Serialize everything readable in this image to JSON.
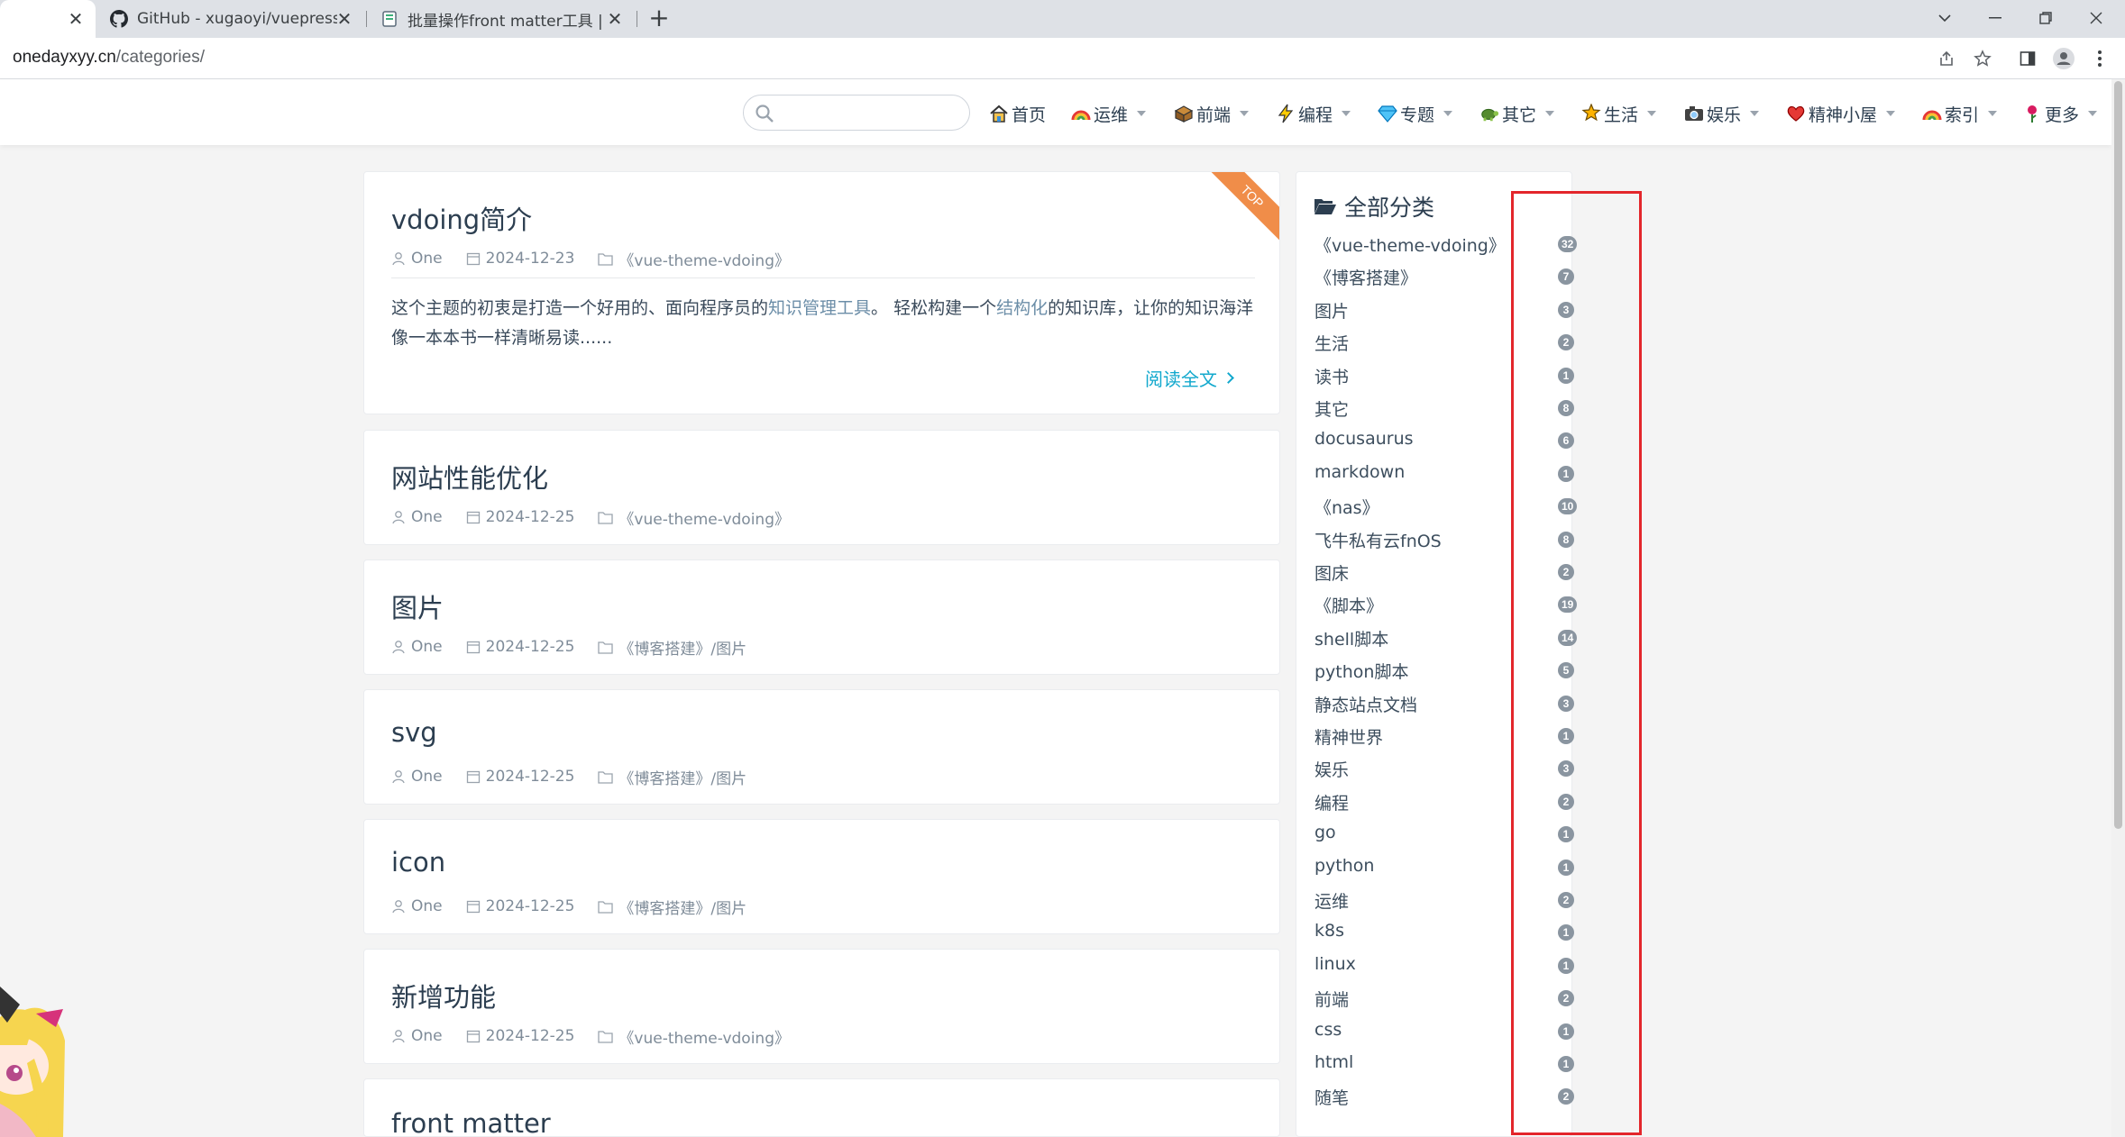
{
  "browser": {
    "tabs": [
      {
        "title": "",
        "active": true
      },
      {
        "title": "GitHub - xugaoyi/vuepress-the",
        "favicon": "github-icon"
      },
      {
        "title": "批量操作front matter工具 | vue",
        "favicon": "page-icon"
      }
    ],
    "url_host": "onedayxyy.cn",
    "url_path": "/categories/"
  },
  "nav": {
    "search_placeholder": "",
    "items": [
      {
        "label": "首页",
        "icon": "home-icon",
        "dropdown": false
      },
      {
        "label": "运维",
        "icon": "rainbow-icon",
        "dropdown": true
      },
      {
        "label": "前端",
        "icon": "box-icon",
        "dropdown": true
      },
      {
        "label": "编程",
        "icon": "lightning-icon",
        "dropdown": true
      },
      {
        "label": "专题",
        "icon": "gem-icon",
        "dropdown": true
      },
      {
        "label": "其它",
        "icon": "turtle-icon",
        "dropdown": true
      },
      {
        "label": "生活",
        "icon": "star-person-icon",
        "dropdown": true
      },
      {
        "label": "娱乐",
        "icon": "camera-icon",
        "dropdown": true
      },
      {
        "label": "精神小屋",
        "icon": "heart-icon",
        "dropdown": true
      },
      {
        "label": "索引",
        "icon": "rainbow-icon",
        "dropdown": true
      },
      {
        "label": "更多",
        "icon": "flower-icon",
        "dropdown": true
      }
    ]
  },
  "posts": [
    {
      "title": "vdoing简介",
      "author": "One",
      "date": "2024-12-23",
      "category": "《vue-theme-vdoing》",
      "sticky_label": "TOP",
      "excerpt_parts": [
        "这个主题的初衷是打造一个好用的、面向程序员的",
        "知识管理工具",
        "。 轻松构建一个",
        "结构化",
        "的知识库，让你的知识海洋像一本本书一样清晰易读......"
      ],
      "read_more": "阅读全文"
    },
    {
      "title": "网站性能优化",
      "author": "One",
      "date": "2024-12-25",
      "category": "《vue-theme-vdoing》"
    },
    {
      "title": "图片",
      "author": "One",
      "date": "2024-12-25",
      "category": "《博客搭建》/图片"
    },
    {
      "title": "svg",
      "author": "One",
      "date": "2024-12-25",
      "category": "《博客搭建》/图片"
    },
    {
      "title": "icon",
      "author": "One",
      "date": "2024-12-25",
      "category": "《博客搭建》/图片"
    },
    {
      "title": "新增功能",
      "author": "One",
      "date": "2024-12-25",
      "category": "《vue-theme-vdoing》"
    },
    {
      "title": "front matter"
    }
  ],
  "categories": {
    "title": "全部分类",
    "items": [
      {
        "name": "《vue-theme-vdoing》",
        "count": "32"
      },
      {
        "name": "《博客搭建》",
        "count": "7"
      },
      {
        "name": "图片",
        "count": "3"
      },
      {
        "name": "生活",
        "count": "2"
      },
      {
        "name": "读书",
        "count": "1"
      },
      {
        "name": "其它",
        "count": "8"
      },
      {
        "name": "docusaurus",
        "count": "6"
      },
      {
        "name": "markdown",
        "count": "1"
      },
      {
        "name": "《nas》",
        "count": "10"
      },
      {
        "name": "飞牛私有云fnOS",
        "count": "8"
      },
      {
        "name": "图床",
        "count": "2"
      },
      {
        "name": "《脚本》",
        "count": "19"
      },
      {
        "name": "shell脚本",
        "count": "14"
      },
      {
        "name": "python脚本",
        "count": "5"
      },
      {
        "name": "静态站点文档",
        "count": "3"
      },
      {
        "name": "精神世界",
        "count": "1"
      },
      {
        "name": "娱乐",
        "count": "3"
      },
      {
        "name": "编程",
        "count": "2"
      },
      {
        "name": "go",
        "count": "1"
      },
      {
        "name": "python",
        "count": "1"
      },
      {
        "name": "运维",
        "count": "2"
      },
      {
        "name": "k8s",
        "count": "1"
      },
      {
        "name": "linux",
        "count": "1"
      },
      {
        "name": "前端",
        "count": "2"
      },
      {
        "name": "css",
        "count": "1"
      },
      {
        "name": "html",
        "count": "1"
      },
      {
        "name": "随笔",
        "count": "2"
      }
    ]
  },
  "colors": {
    "accent": "#11a8cd",
    "highlight_box": "#e3262b",
    "sticky_ribbon": "#f08d49",
    "badge": "#8a95a0"
  }
}
